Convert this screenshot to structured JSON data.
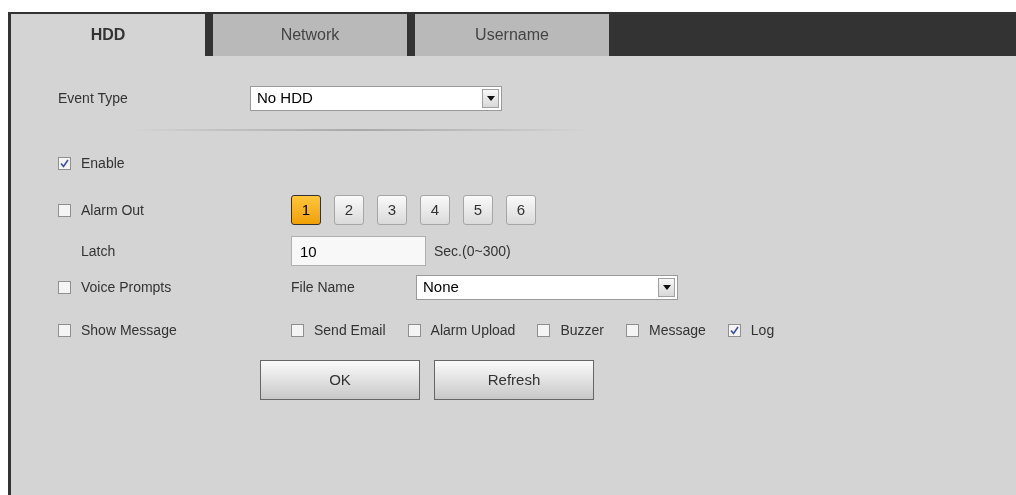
{
  "tabs": [
    {
      "label": "HDD",
      "selected": true
    },
    {
      "label": "Network",
      "selected": false
    },
    {
      "label": "Username",
      "selected": false
    }
  ],
  "event_type": {
    "label": "Event Type",
    "value": "No HDD"
  },
  "enable": {
    "label": "Enable",
    "checked": true
  },
  "alarm_out": {
    "label": "Alarm Out",
    "checked": false,
    "channels": [
      {
        "label": "1",
        "selected": true
      },
      {
        "label": "2",
        "selected": false
      },
      {
        "label": "3",
        "selected": false
      },
      {
        "label": "4",
        "selected": false
      },
      {
        "label": "5",
        "selected": false
      },
      {
        "label": "6",
        "selected": false
      }
    ]
  },
  "latch": {
    "label": "Latch",
    "value": "10",
    "hint": "Sec.(0~300)"
  },
  "voice_prompts": {
    "label": "Voice Prompts",
    "checked": false,
    "file_label": "File Name",
    "file_value": "None"
  },
  "show_message": {
    "label": "Show Message",
    "checked": false
  },
  "actions": [
    {
      "label": "Send Email",
      "checked": false
    },
    {
      "label": "Alarm Upload",
      "checked": false
    },
    {
      "label": "Buzzer",
      "checked": false
    },
    {
      "label": "Message",
      "checked": false
    },
    {
      "label": "Log",
      "checked": true
    }
  ],
  "buttons": [
    "OK",
    "Refresh"
  ]
}
